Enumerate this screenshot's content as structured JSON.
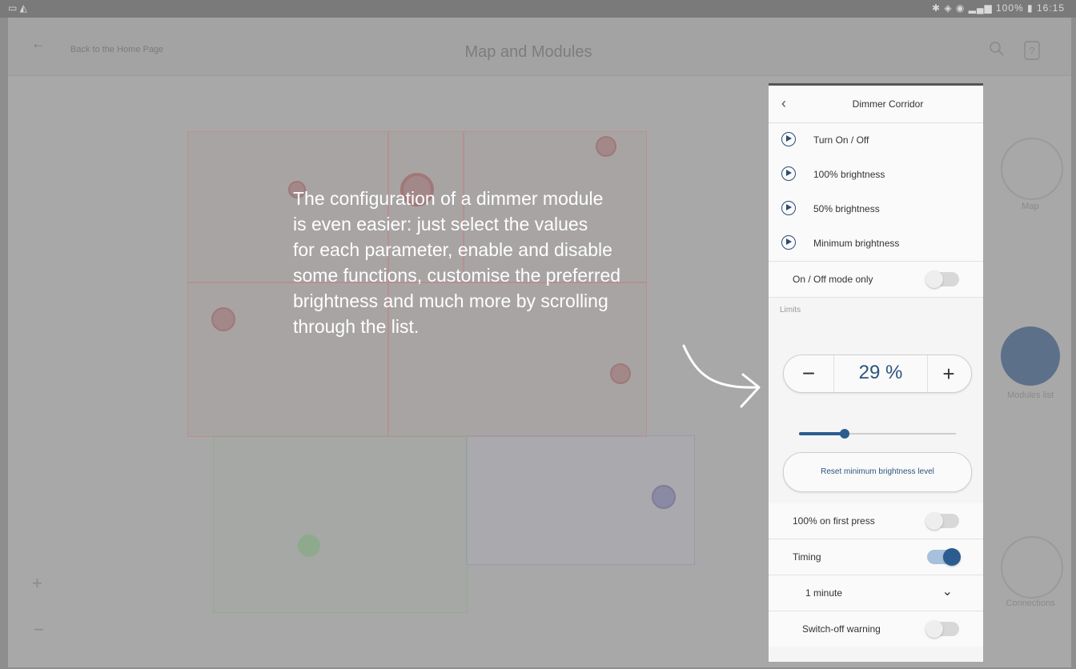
{
  "statusbar": {
    "left": "▭ ◭",
    "right": "✱ ◈ ◉ ▂▄▆ 100% ▮ 16:15"
  },
  "header": {
    "back_link": "Back to the Home Page",
    "title": "Map and Modules"
  },
  "sidebar": [
    {
      "label": "Map",
      "icon": "map-icon"
    },
    {
      "label": "Modules list",
      "icon": "modules-list-icon"
    },
    {
      "label": "Connections",
      "icon": "connections-icon"
    }
  ],
  "map_controls": {
    "zoom_in": "+",
    "zoom_out": "−"
  },
  "overlay": {
    "text_lines": [
      "The configuration of a dimmer module",
      "is even easier: just select the values",
      "for each parameter, enable and disable",
      "some functions, customise the preferred",
      "brightness and much more by scrolling",
      "through the list."
    ]
  },
  "panel": {
    "title": "Dimmer Corridor",
    "actions": [
      "Turn On / Off",
      "100% brightness",
      "50% brightness",
      "Minimum brightness"
    ],
    "onoff_mode": {
      "label": "On / Off mode only",
      "enabled": false
    },
    "limits_label": "Limits",
    "stepper": {
      "minus": "−",
      "value": "29 %",
      "plus": "+"
    },
    "slider": {
      "value_fraction": 0.29
    },
    "reset_button": "Reset minimum brightness level",
    "first_press": {
      "label": "100% on first press",
      "enabled": false
    },
    "timing": {
      "label": "Timing",
      "enabled": true
    },
    "timing_value": "1 minute",
    "switch_off_warning": {
      "label": "Switch-off warning",
      "enabled": false
    }
  },
  "colors": {
    "accent": "#2c5c8f",
    "overlay_text": "#ffffff"
  }
}
